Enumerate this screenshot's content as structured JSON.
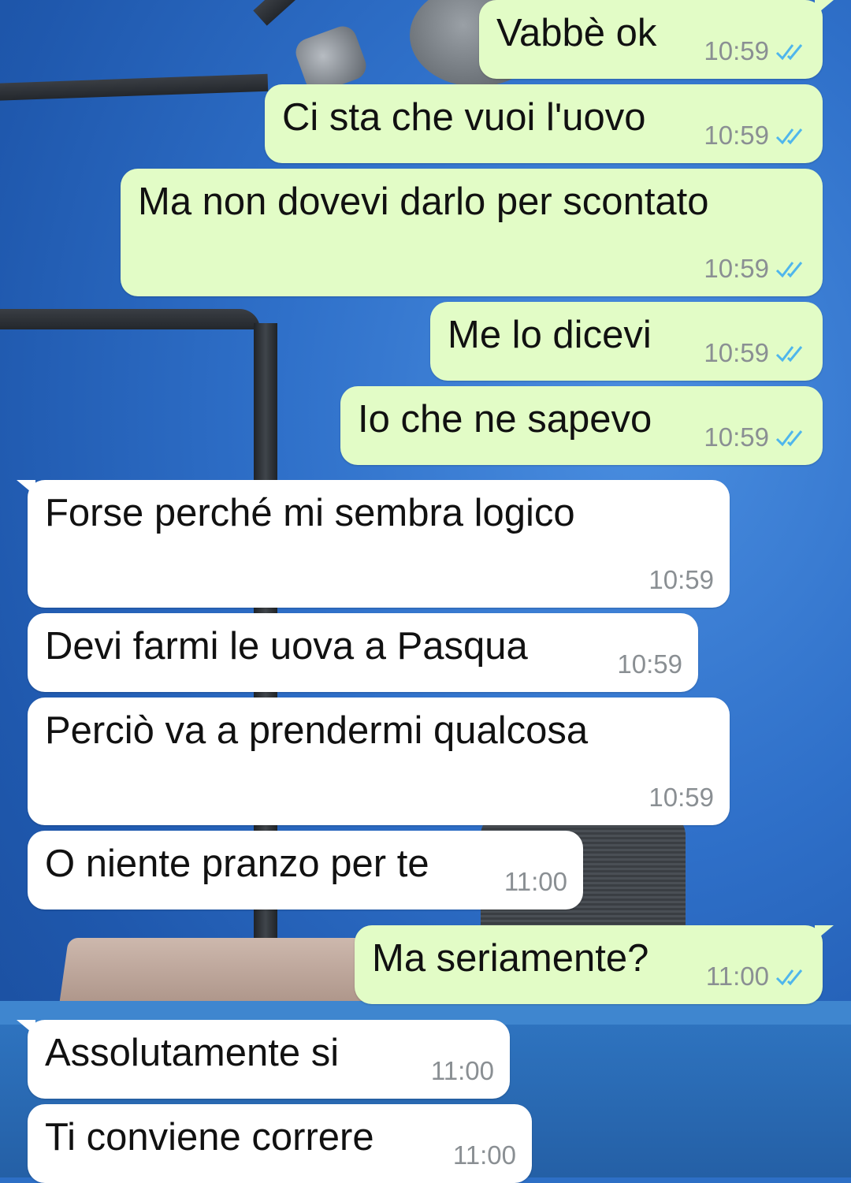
{
  "messages": [
    {
      "text": "Vabbè ok",
      "time": "10:59",
      "direction": "outgoing",
      "status": "read-double-check-icon"
    },
    {
      "text": "Ci sta che vuoi l'uovo",
      "time": "10:59",
      "direction": "outgoing",
      "status": "read-double-check-icon"
    },
    {
      "text": "Ma non dovevi darlo per scontato",
      "time": "10:59",
      "direction": "outgoing",
      "status": "read-double-check-icon"
    },
    {
      "text": "Me lo dicevi",
      "time": "10:59",
      "direction": "outgoing",
      "status": "read-double-check-icon"
    },
    {
      "text": "Io che ne sapevo",
      "time": "10:59",
      "direction": "outgoing",
      "status": "read-double-check-icon"
    },
    {
      "text": "Forse perché mi sembra logico",
      "time": "10:59",
      "direction": "incoming"
    },
    {
      "text": "Devi farmi le uova a Pasqua",
      "time": "10:59",
      "direction": "incoming"
    },
    {
      "text": "Perciò va a prendermi qualcosa",
      "time": "10:59",
      "direction": "incoming"
    },
    {
      "text": "O niente pranzo per te",
      "time": "11:00",
      "direction": "incoming"
    },
    {
      "text": "Ma seriamente?",
      "time": "11:00",
      "direction": "outgoing",
      "status": "read-double-check-icon"
    },
    {
      "text": "Assolutamente si",
      "time": "11:00",
      "direction": "incoming"
    },
    {
      "text": "Ti conviene correre",
      "time": "11:00",
      "direction": "incoming"
    }
  ],
  "colors": {
    "outgoing_bubble": "#e2fcc6",
    "incoming_bubble": "#ffffff",
    "read_tick": "#4fb6ec",
    "timestamp": "#8a8f93"
  }
}
